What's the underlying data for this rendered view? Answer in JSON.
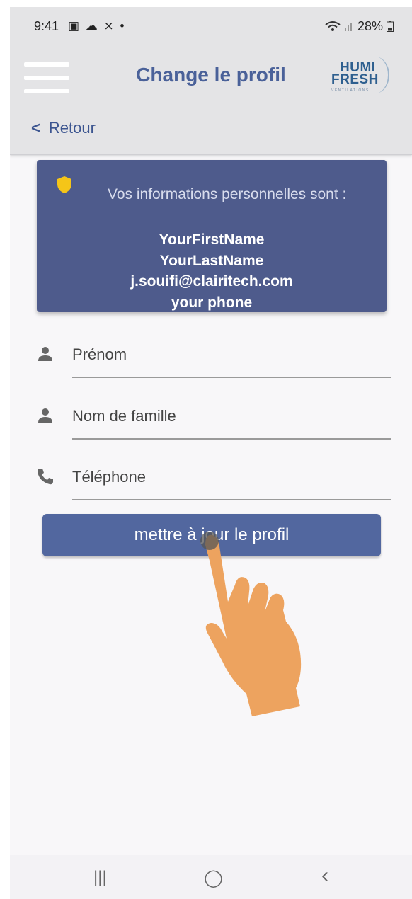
{
  "status_bar": {
    "time": "9:41",
    "notification_icons": "▣ ☁ ⨯ •",
    "battery": "28%"
  },
  "app_bar": {
    "title": "Change le profil",
    "logo": {
      "line1": "HUMI",
      "line2": "FRESH",
      "line3": "VENTILATIONS"
    }
  },
  "back_label": "Retour",
  "info_card": {
    "intro": "Vos informations personnelles sont :",
    "first_name": "YourFirstName",
    "last_name": "YourLastName",
    "email": "j.souifi@clairitech.com",
    "phone": "your phone",
    "shield_color": "#f5c518"
  },
  "form": {
    "first_name_placeholder": "Prénom",
    "last_name_placeholder": "Nom de famille",
    "phone_placeholder": "Téléphone"
  },
  "update_button": "mettre à jour le profil",
  "nav": {
    "recents": "|||",
    "home": "◯",
    "back": "‹"
  },
  "colors": {
    "accent": "#4a6199",
    "card": "#4e5b8c",
    "button": "#52679f",
    "hand": "#eda35f"
  }
}
